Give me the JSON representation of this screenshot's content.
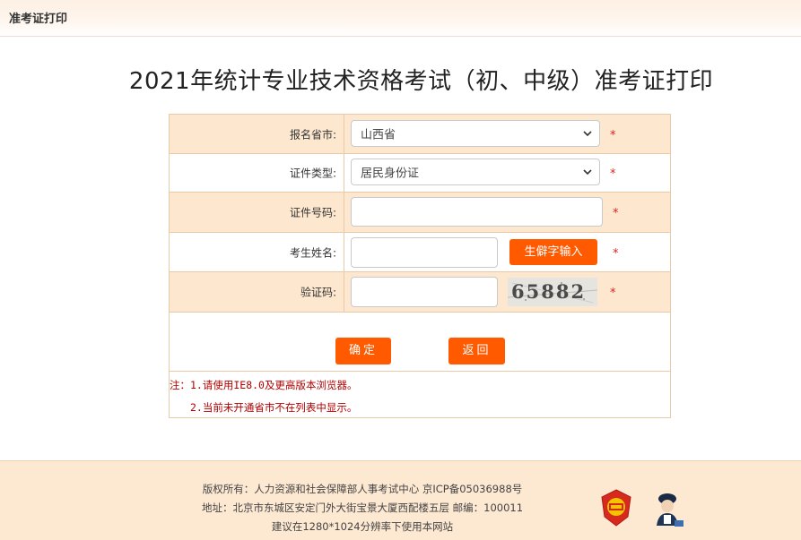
{
  "header": {
    "crumb": "准考证打印"
  },
  "page": {
    "title": "2021年统计专业技术资格考试（初、中级）准考证打印"
  },
  "form": {
    "province_label": "报名省市:",
    "province_value": "山西省",
    "id_type_label": "证件类型:",
    "id_type_value": "居民身份证",
    "id_number_label": "证件号码:",
    "id_number_value": "",
    "name_label": "考生姓名:",
    "name_value": "",
    "rare_char_button": "生僻字输入",
    "captcha_label": "验证码:",
    "captcha_value": "",
    "captcha_text": "65882",
    "required_mark": "*",
    "confirm_button": "确定",
    "back_button": "返回"
  },
  "notes": {
    "line1": "注：1.请使用IE8.0及更高版本浏览器。",
    "line2": "2.当前未开通省市不在列表中显示。"
  },
  "footer": {
    "copyright": "版权所有：人力资源和社会保障部人事考试中心 京ICP备05036988号",
    "address": "地址：北京市东城区安定门外大街宝景大厦西配楼五层 邮编：100011",
    "suggestion": "建议在1280*1024分辨率下使用本网站"
  },
  "colors": {
    "accent": "#ff5a00",
    "row_tan": "#fde7cf",
    "required": "#d9231c"
  }
}
